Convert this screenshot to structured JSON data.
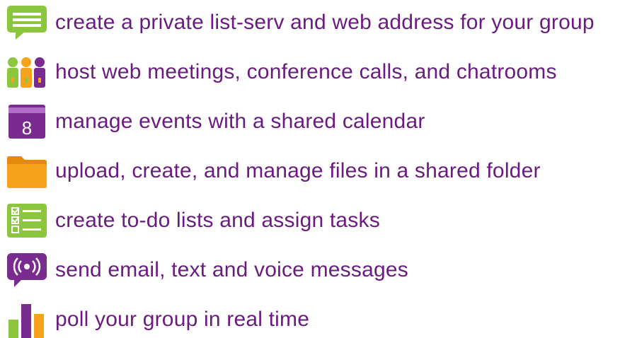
{
  "colors": {
    "text": "#6a1b7f",
    "green": "#8cc63f",
    "purple": "#7a2b8f",
    "orange": "#f7a21b",
    "white": "#ffffff"
  },
  "features": [
    {
      "icon": "message-bubble-icon",
      "text": "create a private list-serv and web address for your group"
    },
    {
      "icon": "people-group-icon",
      "text": "host web meetings, conference calls, and chatrooms"
    },
    {
      "icon": "calendar-icon",
      "calendar_day": "8",
      "text": "manage events with a shared calendar"
    },
    {
      "icon": "folder-icon",
      "text": "upload, create, and manage files in a shared folder"
    },
    {
      "icon": "checklist-icon",
      "text": "create to-do lists and assign tasks"
    },
    {
      "icon": "broadcast-bubble-icon",
      "text": "send email, text and voice messages"
    },
    {
      "icon": "bar-chart-icon",
      "text": "poll your group in real time"
    }
  ]
}
